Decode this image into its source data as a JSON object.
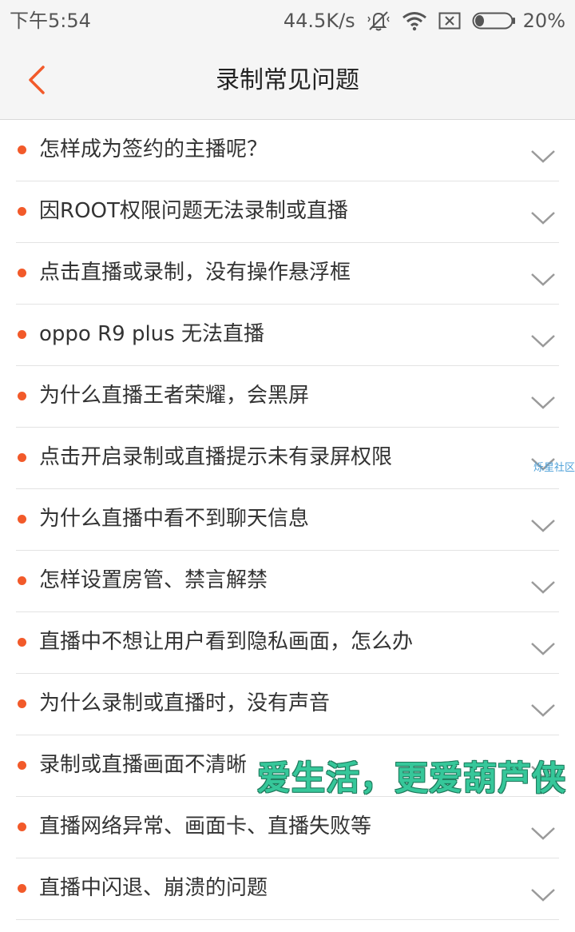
{
  "status_bar": {
    "time": "下午5:54",
    "speed": "44.5K/s",
    "battery": "20%"
  },
  "header": {
    "title": "录制常见问题"
  },
  "faq": [
    {
      "label": "怎样成为签约的主播呢？"
    },
    {
      "label": "因ROOT权限问题无法录制或直播"
    },
    {
      "label": "点击直播或录制，没有操作悬浮框"
    },
    {
      "label": "oppo R9 plus 无法直播"
    },
    {
      "label": "为什么直播王者荣耀，会黑屏"
    },
    {
      "label": "点击开启录制或直播提示未有录屏权限"
    },
    {
      "label": "为什么直播中看不到聊天信息"
    },
    {
      "label": "怎样设置房管、禁言解禁"
    },
    {
      "label": "直播中不想让用户看到隐私画面，怎么办"
    },
    {
      "label": "为什么录制或直播时，没有声音"
    },
    {
      "label": "录制或直播画面不清晰"
    },
    {
      "label": "直播网络异常、画面卡、直播失败等"
    },
    {
      "label": "直播中闪退、崩溃的问题"
    }
  ],
  "watermarks": {
    "side": "烁星社区",
    "main": "爱生活，更爱葫芦侠"
  },
  "colors": {
    "accent": "#f25a2a",
    "chevron": "#9a9a9a"
  }
}
